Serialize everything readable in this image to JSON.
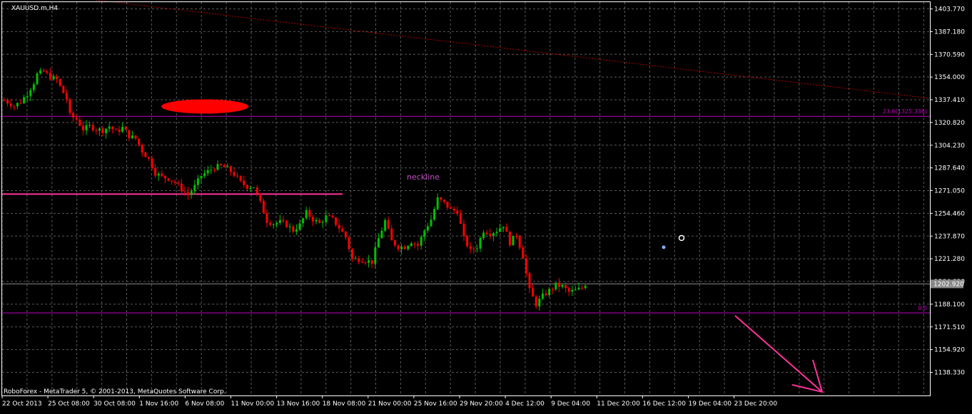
{
  "window": {
    "symbol_title": "XAUUSD.m,H4",
    "copyright": "RoboForex - MetaTrader 5, © 2001-2013, MetaQuotes Software Corp."
  },
  "colors": {
    "background": "#000000",
    "frame": "#ffffff",
    "grid": "#5a5a5a",
    "bull": "#00c000",
    "bear": "#ff0000",
    "fib_line": "#c000c0",
    "neckline": "#ff3399",
    "trendline": "#b00000",
    "ellipse": "#ff0000",
    "arrow": "#ff3399",
    "annotation": "#c050c0"
  },
  "chart_data": {
    "type": "candlestick",
    "symbol": "XAUUSD.m",
    "timeframe": "H4",
    "y_ticks": [
      "1403.770",
      "1387.180",
      "1370.590",
      "1354.000",
      "1337.410",
      "1320.820",
      "1304.230",
      "1287.640",
      "1271.050",
      "1254.460",
      "1237.870",
      "1221.280",
      "1204.690",
      "1188.100",
      "1171.510",
      "1154.920",
      "1138.330"
    ],
    "ylim": [
      1129.2,
      1410.5
    ],
    "x_ticks": [
      "22 Oct 2013",
      "25 Oct 08:00",
      "30 Oct 08:00",
      "1 Nov 16:00",
      "6 Nov 08:00",
      "11 Nov 00:00",
      "13 Nov 16:00",
      "18 Nov 08:00",
      "21 Nov 00:00",
      "25 Nov 16:00",
      "29 Nov 20:00",
      "4 Dec 12:00",
      "9 Dec 04:00",
      "11 Dec 20:00",
      "16 Dec 12:00",
      "19 Dec 04:00",
      "23 Dec 20:00"
    ],
    "current_price": "1202.920",
    "price_path": [
      [
        0,
        1337
      ],
      [
        3,
        1333
      ],
      [
        5,
        1336
      ],
      [
        7,
        1342
      ],
      [
        9,
        1350
      ],
      [
        10,
        1356
      ],
      [
        12,
        1358
      ],
      [
        14,
        1354
      ],
      [
        16,
        1352
      ],
      [
        17,
        1347
      ],
      [
        19,
        1338
      ],
      [
        20,
        1326
      ],
      [
        22,
        1323
      ],
      [
        24,
        1316
      ],
      [
        26,
        1318
      ],
      [
        28,
        1316
      ],
      [
        30,
        1315
      ],
      [
        32,
        1318
      ],
      [
        34,
        1314
      ],
      [
        36,
        1317
      ],
      [
        38,
        1311
      ],
      [
        40,
        1309
      ],
      [
        42,
        1300
      ],
      [
        44,
        1294
      ],
      [
        46,
        1284
      ],
      [
        48,
        1281
      ],
      [
        50,
        1280
      ],
      [
        52,
        1277
      ],
      [
        54,
        1272
      ],
      [
        56,
        1268
      ],
      [
        58,
        1274
      ],
      [
        60,
        1282
      ],
      [
        62,
        1285
      ],
      [
        64,
        1288
      ],
      [
        66,
        1289
      ],
      [
        68,
        1287
      ],
      [
        70,
        1283
      ],
      [
        72,
        1277
      ],
      [
        74,
        1274
      ],
      [
        76,
        1274
      ],
      [
        78,
        1262
      ],
      [
        80,
        1249
      ],
      [
        82,
        1247
      ],
      [
        84,
        1248
      ],
      [
        86,
        1246
      ],
      [
        88,
        1242
      ],
      [
        90,
        1246
      ],
      [
        92,
        1255
      ],
      [
        94,
        1250
      ],
      [
        96,
        1247
      ],
      [
        98,
        1252
      ],
      [
        100,
        1250
      ],
      [
        102,
        1244
      ],
      [
        104,
        1237
      ],
      [
        106,
        1221
      ],
      [
        108,
        1221
      ],
      [
        110,
        1220
      ],
      [
        112,
        1219
      ],
      [
        114,
        1236
      ],
      [
        116,
        1249
      ],
      [
        118,
        1234
      ],
      [
        120,
        1230
      ],
      [
        122,
        1230
      ],
      [
        124,
        1234
      ],
      [
        126,
        1231
      ],
      [
        128,
        1242
      ],
      [
        130,
        1250
      ],
      [
        132,
        1265
      ],
      [
        134,
        1262
      ],
      [
        136,
        1257
      ],
      [
        138,
        1256
      ],
      [
        140,
        1236
      ],
      [
        142,
        1227
      ],
      [
        144,
        1230
      ],
      [
        146,
        1242
      ],
      [
        148,
        1240
      ],
      [
        150,
        1242
      ],
      [
        152,
        1246
      ],
      [
        154,
        1233
      ],
      [
        156,
        1239
      ],
      [
        158,
        1223
      ],
      [
        160,
        1198
      ],
      [
        162,
        1188
      ],
      [
        164,
        1194
      ],
      [
        166,
        1198
      ],
      [
        168,
        1202
      ],
      [
        170,
        1201
      ],
      [
        172,
        1197
      ],
      [
        174,
        1198
      ],
      [
        176,
        1200
      ],
      [
        177,
        1203
      ]
    ],
    "annotations": {
      "fib_23_6_label": "23.6(1325.336)",
      "fib_23_6_price": 1325.336,
      "fib_0_label": "0.0",
      "fib_0_price": 1181.7,
      "neckline_label": "neckline",
      "neckline_price": 1268.5,
      "current_price_value": 1202.92,
      "ellipse_price": 1332.5,
      "trendline_start_price": 1410.5,
      "trendline_end_price": 1338.5
    }
  }
}
